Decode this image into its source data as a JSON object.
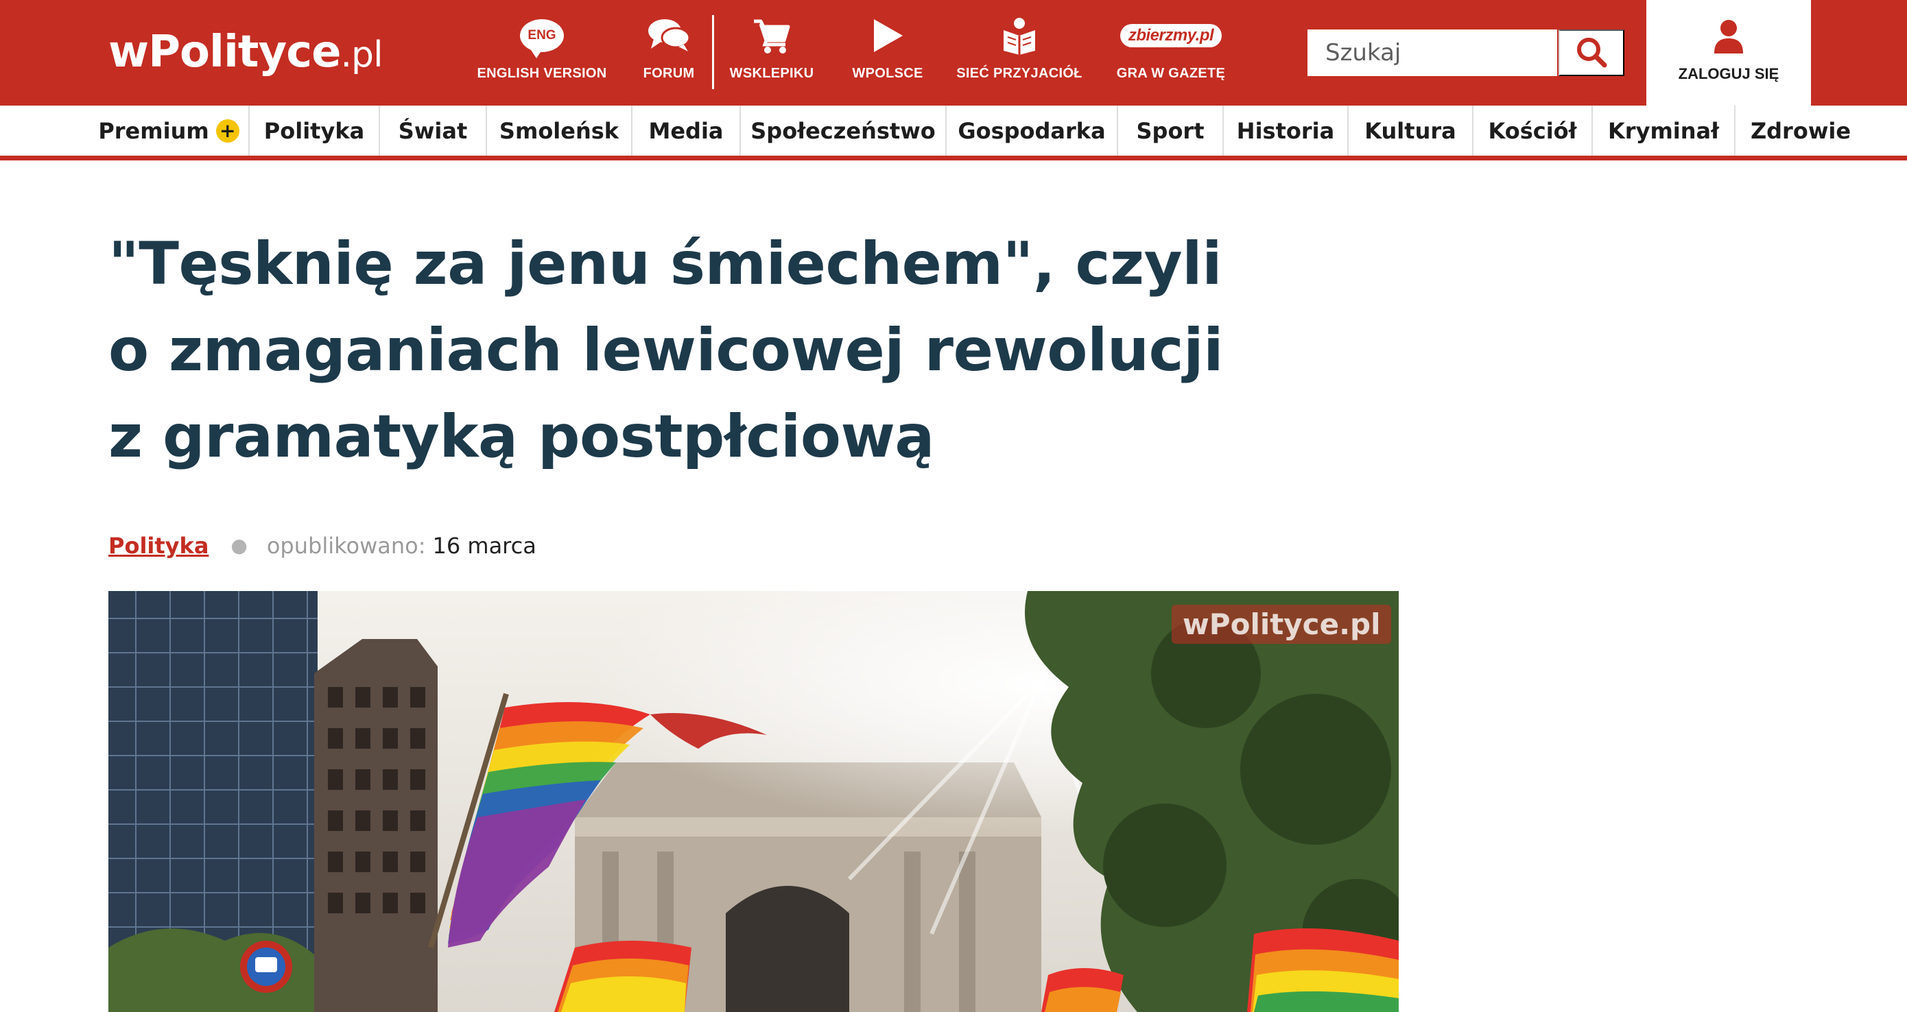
{
  "brand": {
    "name": "wPolityce",
    "tld": ".pl"
  },
  "topnav": {
    "items": [
      {
        "icon": "eng-speech-bubble-icon",
        "badge": "ENG",
        "label": "ENGLISH VERSION"
      },
      {
        "icon": "chat-bubbles-icon",
        "label": "FORUM"
      },
      {
        "icon": "shopping-cart-icon",
        "label": "WSKLEPIKU"
      },
      {
        "icon": "play-icon",
        "label": "WPOLSCE"
      },
      {
        "icon": "book-reader-icon",
        "label": "SIEĆ PRZYJACIÓŁ"
      },
      {
        "icon": "zbierzmy-logo-icon",
        "badge": "zbierzmy.pl",
        "label": "GRA W GAZETĘ"
      }
    ]
  },
  "search": {
    "placeholder": "Szukaj",
    "icon": "search-icon"
  },
  "login": {
    "label": "ZALOGUJ SIĘ",
    "icon": "user-icon"
  },
  "categories": [
    {
      "label": "Premium",
      "badge": "+"
    },
    {
      "label": "Polityka"
    },
    {
      "label": "Świat"
    },
    {
      "label": "Smoleńsk"
    },
    {
      "label": "Media"
    },
    {
      "label": "Społeczeństwo"
    },
    {
      "label": "Gospodarka"
    },
    {
      "label": "Sport"
    },
    {
      "label": "Historia"
    },
    {
      "label": "Kultura"
    },
    {
      "label": "Kościół"
    },
    {
      "label": "Kryminał"
    },
    {
      "label": "Zdrowie"
    }
  ],
  "article": {
    "title": "\"Tęsknię za jenu śmiechem\", czyli o zmaganiach lewicowej rewolucji z gramatyką postpłciową",
    "section": "Polityka",
    "published_label": "opublikowano:",
    "published_date": "16 marca",
    "image": {
      "watermark": "wPolityce.pl",
      "subject": "rainbow flags in front of a city building"
    }
  },
  "colors": {
    "brand_red": "#c42d22",
    "headline": "#1d3a4a",
    "premium_yellow": "#f5c400"
  }
}
